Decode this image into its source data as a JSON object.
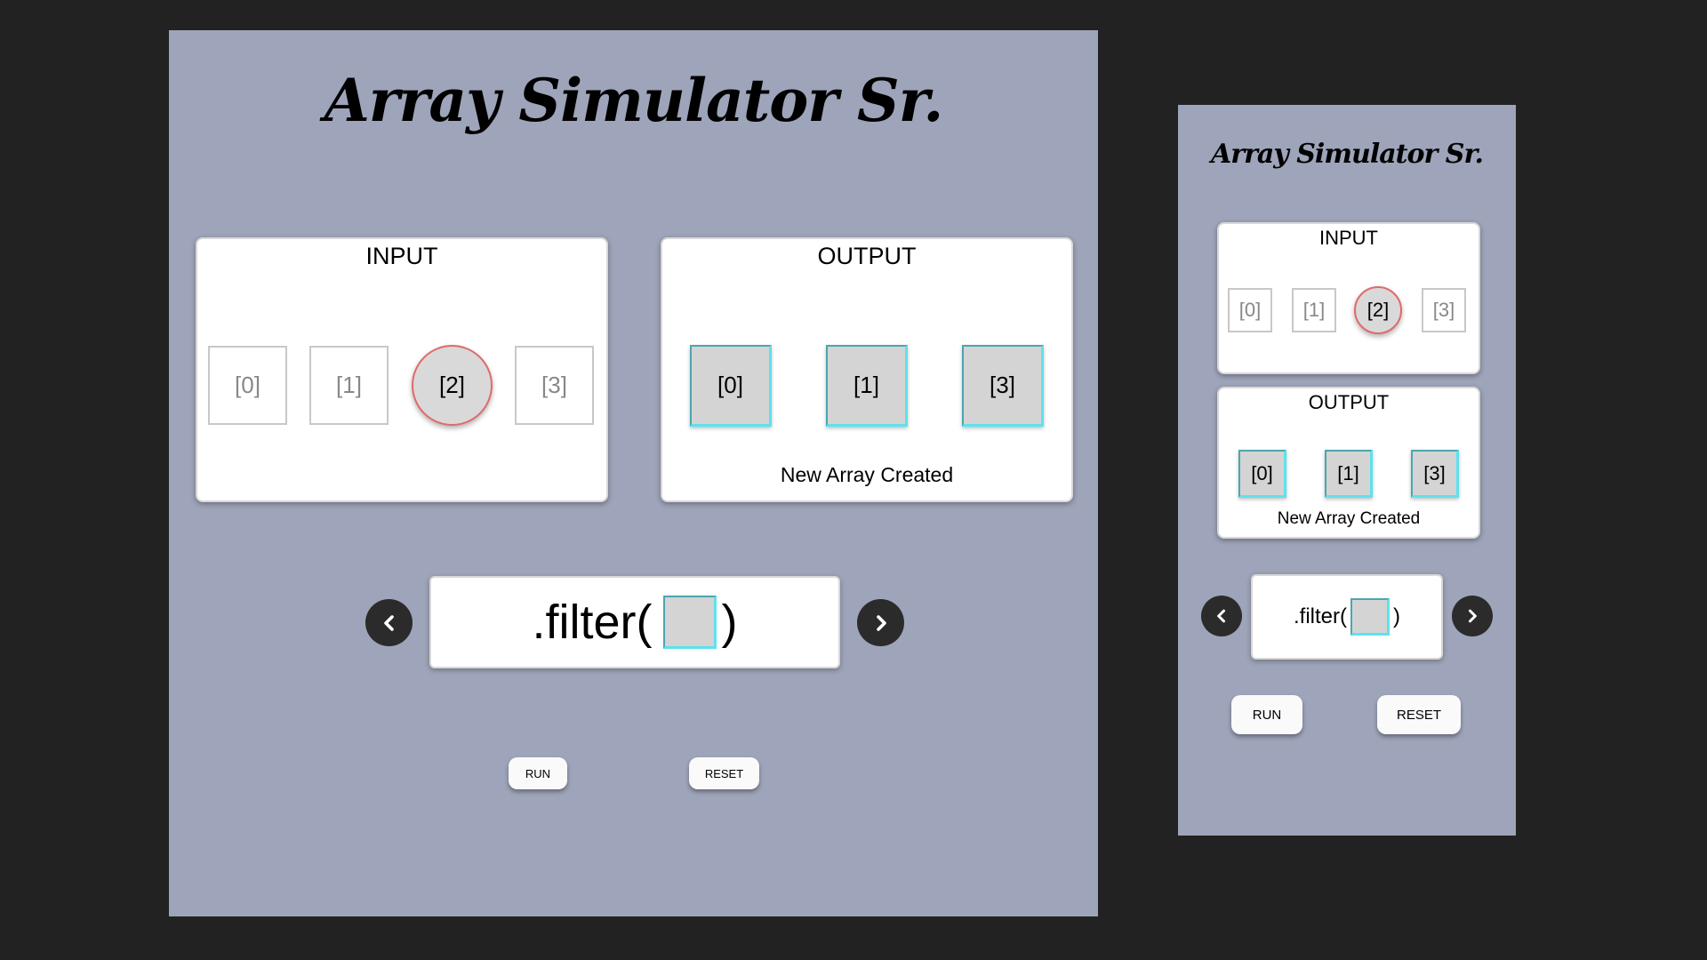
{
  "app": {
    "title": "Array Simulator Sr."
  },
  "input": {
    "heading": "INPUT",
    "items": [
      "[0]",
      "[1]",
      "[2]",
      "[3]"
    ],
    "active_index": 2
  },
  "output": {
    "heading": "OUTPUT",
    "items": [
      "[0]",
      "[1]",
      "[3]"
    ],
    "status": "New Array Created"
  },
  "method": {
    "prefix": ".filter(",
    "suffix": ")"
  },
  "nav": {
    "prev_icon": "chevron-left-icon",
    "next_icon": "chevron-right-icon"
  },
  "buttons": {
    "run": "RUN",
    "reset": "RESET"
  },
  "colors": {
    "background": "#222222",
    "frame": "#9ea4b9",
    "active_border": "#e06a6a",
    "output_border": "#5de2ee"
  }
}
